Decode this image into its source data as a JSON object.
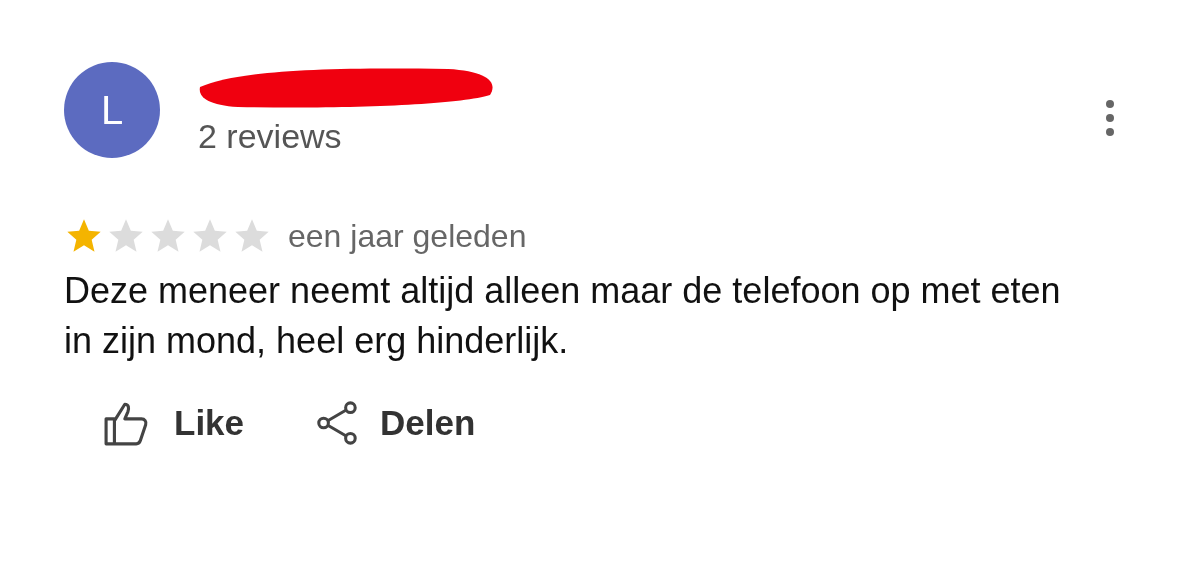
{
  "review": {
    "avatar_letter": "L",
    "reviewer_meta": "2 reviews",
    "name_redacted": true,
    "stars": 1,
    "time": "een jaar geleden",
    "text": "Deze meneer neemt altijd alleen maar de telefoon op met eten in zijn mond, heel erg hinderlijk."
  },
  "actions": [
    {
      "kind": "like",
      "label": "Like"
    },
    {
      "kind": "share",
      "label": "Delen"
    }
  ]
}
